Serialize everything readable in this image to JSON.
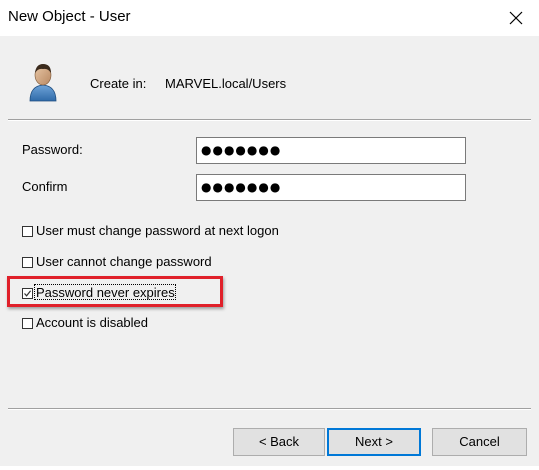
{
  "window": {
    "title": "New Object - User",
    "close_icon": "close-icon"
  },
  "header": {
    "icon": "user-icon",
    "create_in_label": "Create in:",
    "create_in_value": "MARVEL.local/Users"
  },
  "form": {
    "password_label": "Password:",
    "password_value": "●●●●●●●",
    "confirm_label": "Confirm",
    "confirm_value": "●●●●●●●"
  },
  "options": [
    {
      "label": "User must change password at next logon",
      "checked": false
    },
    {
      "label": "User cannot change password",
      "checked": false
    },
    {
      "label": "Password never expires",
      "checked": true,
      "highlighted": true
    },
    {
      "label": "Account is disabled",
      "checked": false
    }
  ],
  "buttons": {
    "back": "< Back",
    "next": "Next >",
    "cancel": "Cancel"
  },
  "colors": {
    "highlight": "#e0202a",
    "default_button_border": "#0078d7"
  }
}
